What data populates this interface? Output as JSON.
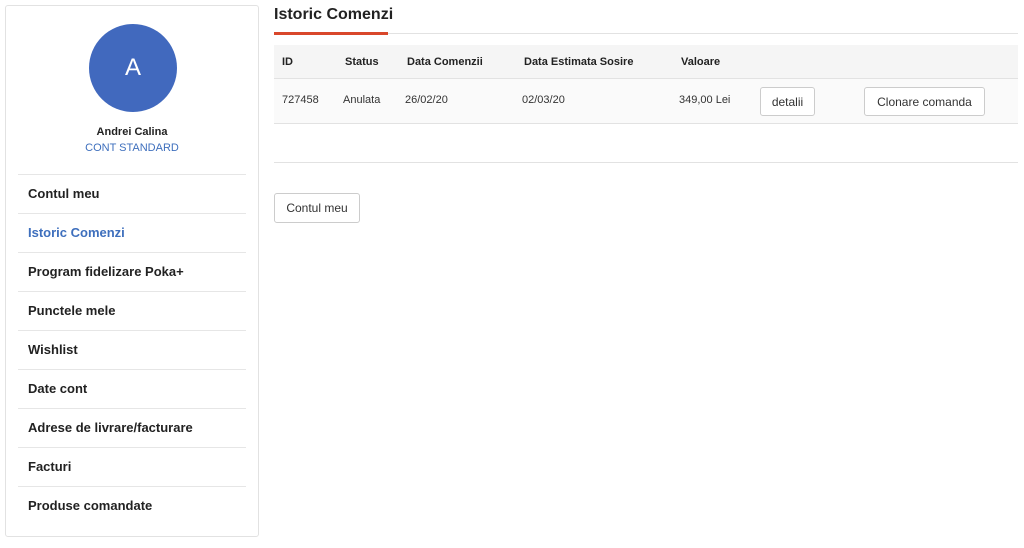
{
  "user": {
    "avatar_initial": "A",
    "name": "Andrei Calina",
    "account_type": "CONT STANDARD"
  },
  "sidebar": {
    "items": [
      {
        "label": "Contul meu",
        "active": false
      },
      {
        "label": "Istoric Comenzi",
        "active": true
      },
      {
        "label": "Program fidelizare Poka+",
        "active": false
      },
      {
        "label": "Punctele mele",
        "active": false
      },
      {
        "label": "Wishlist",
        "active": false
      },
      {
        "label": "Date cont",
        "active": false
      },
      {
        "label": "Adrese de livrare/facturare",
        "active": false
      },
      {
        "label": "Facturi",
        "active": false
      },
      {
        "label": "Produse comandate",
        "active": false
      }
    ]
  },
  "main": {
    "title": "Istoric Comenzi",
    "accent_color": "#d9472b",
    "table": {
      "headers": [
        "ID",
        "Status",
        "Data Comenzii",
        "Data Estimata Sosire",
        "Valoare"
      ],
      "rows": [
        {
          "id": "727458",
          "status": "Anulata",
          "order_date": "26/02/20",
          "eta": "02/03/20",
          "value": "349,00 Lei",
          "details_label": "detalii",
          "clone_label": "Clonare comanda"
        }
      ]
    },
    "back_button_label": "Contul meu"
  }
}
